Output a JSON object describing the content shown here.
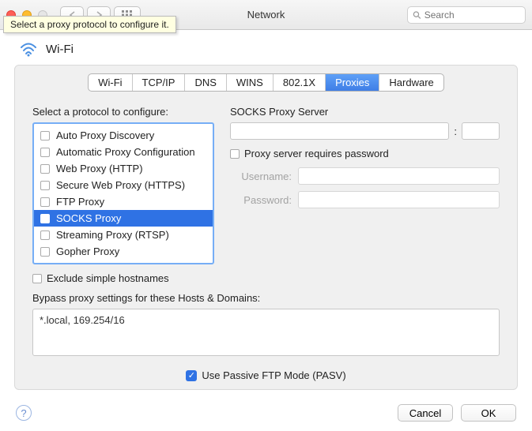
{
  "window": {
    "title": "Network",
    "search_placeholder": "Search",
    "tooltip": "Select a proxy protocol to configure it."
  },
  "connection": {
    "name": "Wi-Fi"
  },
  "tabs": [
    "Wi-Fi",
    "TCP/IP",
    "DNS",
    "WINS",
    "802.1X",
    "Proxies",
    "Hardware"
  ],
  "active_tab": "Proxies",
  "left": {
    "label": "Select a protocol to configure:",
    "protocols": [
      {
        "label": "Auto Proxy Discovery",
        "checked": false,
        "selected": false
      },
      {
        "label": "Automatic Proxy Configuration",
        "checked": false,
        "selected": false
      },
      {
        "label": "Web Proxy (HTTP)",
        "checked": false,
        "selected": false
      },
      {
        "label": "Secure Web Proxy (HTTPS)",
        "checked": false,
        "selected": false
      },
      {
        "label": "FTP Proxy",
        "checked": false,
        "selected": false
      },
      {
        "label": "SOCKS Proxy",
        "checked": false,
        "selected": true
      },
      {
        "label": "Streaming Proxy (RTSP)",
        "checked": false,
        "selected": false
      },
      {
        "label": "Gopher Proxy",
        "checked": false,
        "selected": false
      }
    ],
    "exclude_simple_label": "Exclude simple hostnames",
    "exclude_simple_checked": false
  },
  "right": {
    "server_label": "SOCKS Proxy Server",
    "host_value": "",
    "port_value": "",
    "colon": ":",
    "requires_pw_label": "Proxy server requires password",
    "requires_pw_checked": false,
    "username_label": "Username:",
    "username_value": "",
    "password_label": "Password:",
    "password_value": ""
  },
  "bypass": {
    "label": "Bypass proxy settings for these Hosts & Domains:",
    "value": "*.local, 169.254/16"
  },
  "pasv": {
    "label": "Use Passive FTP Mode (PASV)",
    "checked": true
  },
  "buttons": {
    "cancel": "Cancel",
    "ok": "OK",
    "help": "?"
  }
}
